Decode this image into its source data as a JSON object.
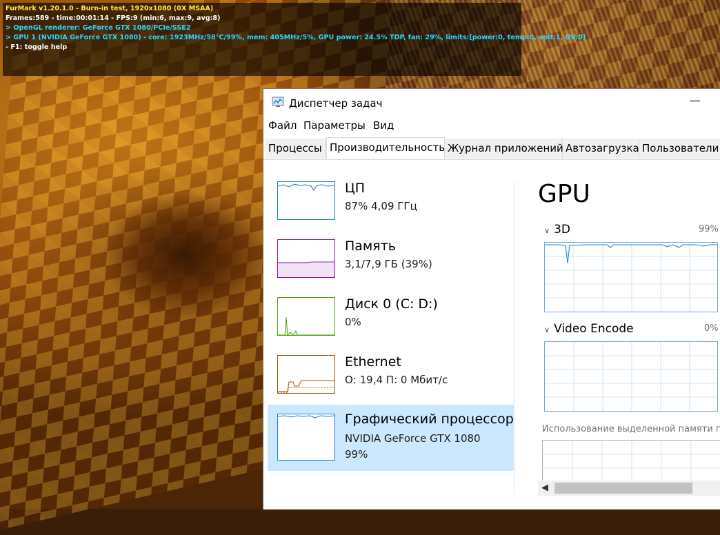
{
  "furmark": {
    "line1": "FurMark v1.20.1.0 - Burn-in test, 1920x1080 (0X MSAA)",
    "line2": "Frames:589 - time:00:01:14 - FPS:9 (min:6, max:9, avg:8)",
    "line3": "> OpenGL renderer: GeForce GTX 1080/PCIe/SSE2",
    "line4": "> GPU 1 (NVIDIA GeForce GTX 1080) - core: 1923MHz/58°C/99%, mem: 405MHz/5%, GPU power: 24.5% TDP, fan: 29%, limits:[power:0, temp:0, volt:1, OV:0]",
    "line5": "- F1: toggle help"
  },
  "window": {
    "title": "Диспетчер задач",
    "minimize": "—"
  },
  "menu": [
    "Файл",
    "Параметры",
    "Вид"
  ],
  "tabs": [
    "Процессы",
    "Производительность",
    "Журнал приложений",
    "Автозагрузка",
    "Пользователи"
  ],
  "active_tab": "Производительность",
  "perf_items": [
    {
      "name": "ЦП",
      "sub1": "87%  4,09 ГГц",
      "color": "#1c7fc1"
    },
    {
      "name": "Память",
      "sub1": "3,1/7,9 ГБ (39%)",
      "color": "#8b12ae"
    },
    {
      "name": "Диск 0 (C: D:)",
      "sub1": "0%",
      "color": "#4da60c"
    },
    {
      "name": "Ethernet",
      "sub1": "О: 19,4  П: 0 Мбит/с",
      "color": "#a74f01"
    },
    {
      "name": "Графический процессор",
      "sub1": "NVIDIA GeForce GTX 1080",
      "sub2": "99%",
      "color": "#1c7fc1"
    }
  ],
  "gpu_panel": {
    "title": "GPU",
    "engine1": {
      "label": "3D",
      "percent": "99%",
      "value": 99
    },
    "engine2": {
      "label": "Video Encode",
      "percent": "0%",
      "value": 0
    },
    "dedicated_memory_label": "Использование выделенной памяти гр"
  },
  "colors": {
    "selection": "#cce8ff",
    "graph_border": "#6fa8dc",
    "gpu_line": "#1c7fc1"
  }
}
